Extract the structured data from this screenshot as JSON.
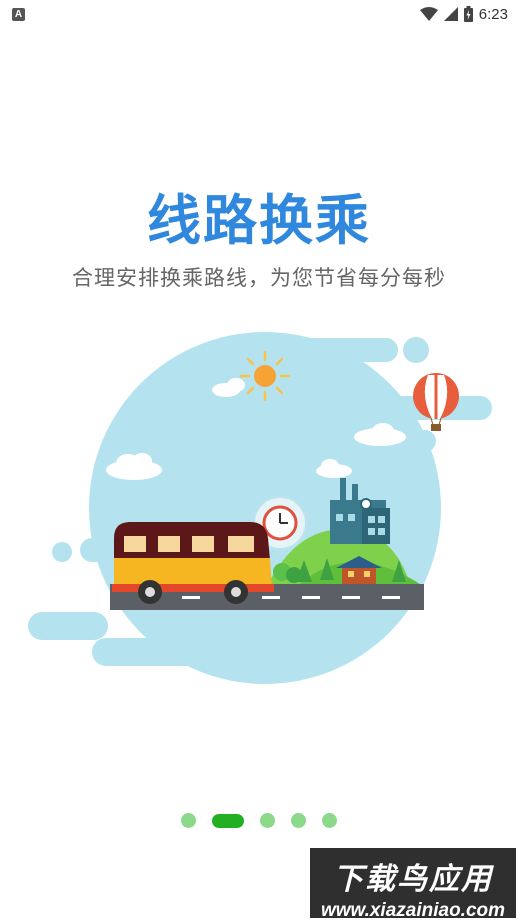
{
  "status_bar": {
    "time": "6:23",
    "notification_icon": "A"
  },
  "onboarding": {
    "title": "线路换乘",
    "subtitle": "合理安排换乘路线，为您节省每分每秒",
    "current_page": 2,
    "total_pages": 5
  },
  "watermark": {
    "title": "下载鸟应用",
    "url": "www.xiazainiao.com"
  },
  "colors": {
    "title": "#2f88dd",
    "dot_active": "#22b022",
    "dot_inactive": "#8cd98c",
    "sky": "#b4e3ef"
  }
}
